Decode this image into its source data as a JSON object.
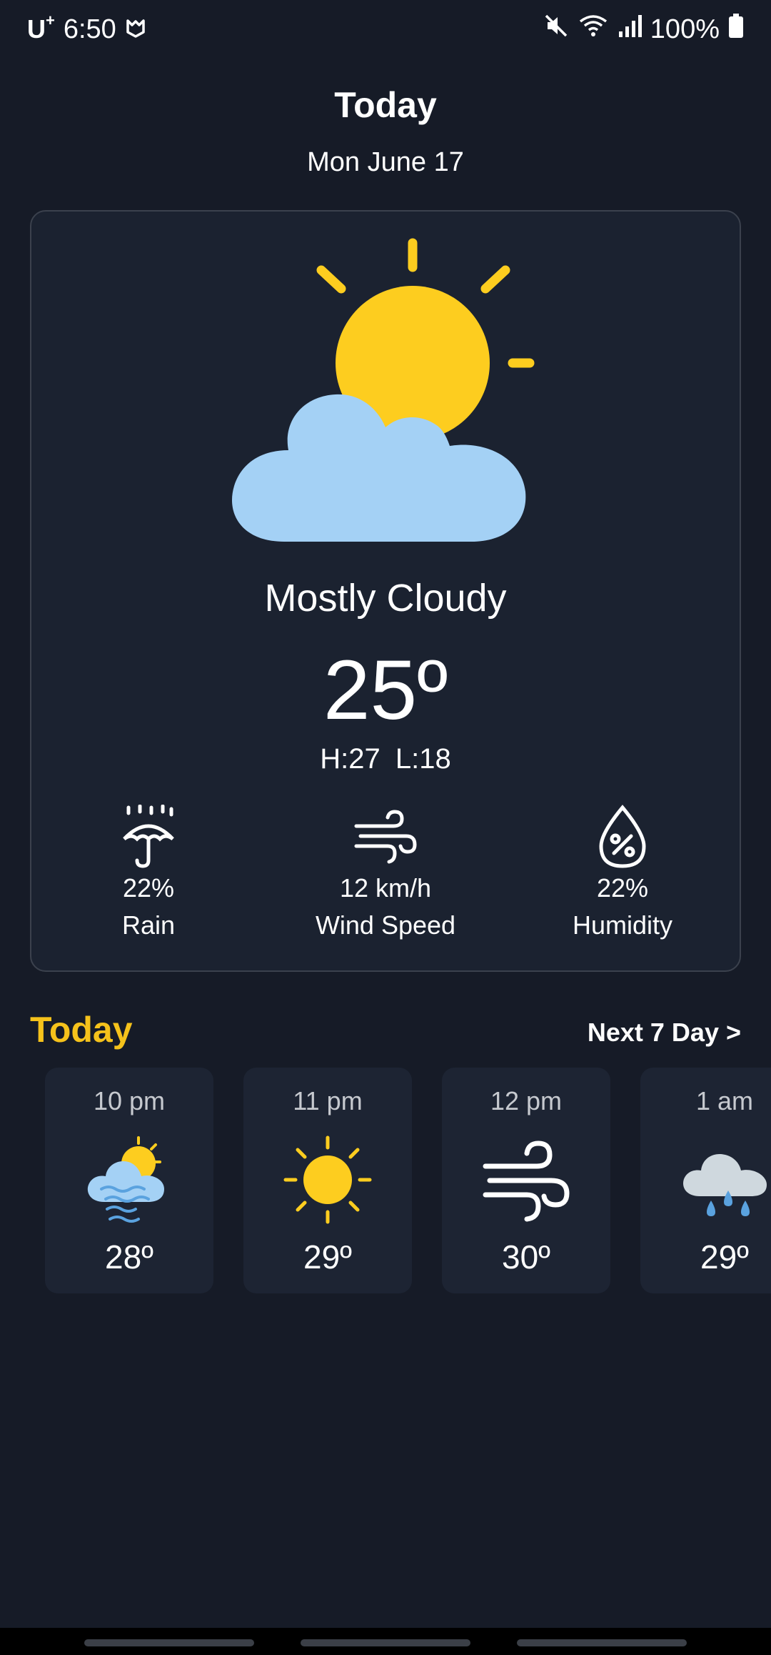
{
  "status_bar": {
    "carrier": "U",
    "carrier_sup": "+",
    "time": "6:50",
    "battery": "100%"
  },
  "header": {
    "title": "Today",
    "date": "Mon June 17"
  },
  "current": {
    "condition": "Mostly Cloudy",
    "temperature": "25º",
    "high_low": "H:27  L:18",
    "icon": "partly-cloudy-sun-icon",
    "metrics": [
      {
        "value": "22%",
        "label": "Rain",
        "icon": "umbrella-rain-icon"
      },
      {
        "value": "12 km/h",
        "label": "Wind Speed",
        "icon": "wind-icon"
      },
      {
        "value": "22%",
        "label": "Humidity",
        "icon": "humidity-drop-icon"
      }
    ]
  },
  "hourly_section": {
    "title": "Today",
    "next_link": "Next 7 Day >"
  },
  "hourly": [
    {
      "time": "10 pm",
      "temp": "28º",
      "icon": "fog-cloud-sun-icon"
    },
    {
      "time": "11 pm",
      "temp": "29º",
      "icon": "sun-icon"
    },
    {
      "time": "12 pm",
      "temp": "30º",
      "icon": "wind-icon"
    },
    {
      "time": "1 am",
      "temp": "29º",
      "icon": "rain-cloud-icon"
    }
  ],
  "colors": {
    "background": "#161b27",
    "card": "#1b2230",
    "accent": "#f5c21b",
    "sun": "#fdcd1f",
    "cloud": "#a4d1f5"
  }
}
